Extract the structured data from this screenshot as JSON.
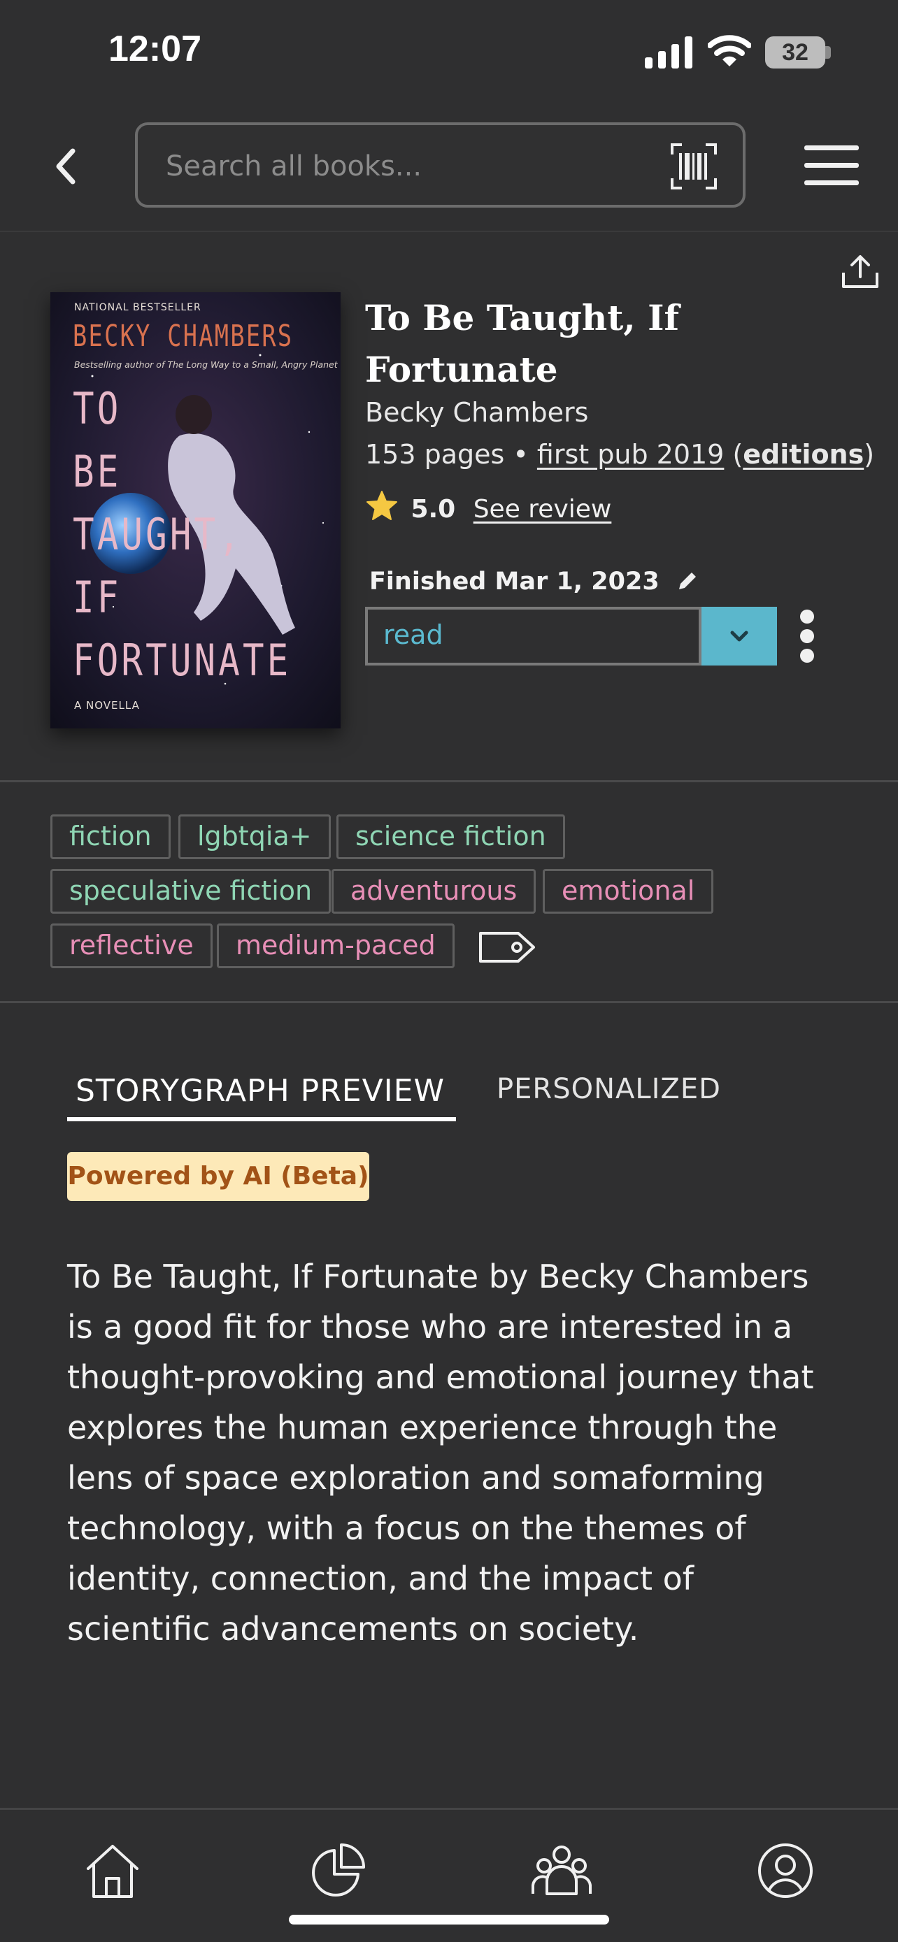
{
  "status_bar": {
    "time": "12:07",
    "battery": "32"
  },
  "header": {
    "search_placeholder": "Search all books...",
    "back_icon": "chevron-left-icon",
    "barcode_icon": "barcode-scan-icon",
    "menu_icon": "hamburger-menu-icon"
  },
  "book": {
    "title": "To Be Taught, If Fortunate",
    "author": "Becky Chambers",
    "pages": "153 pages",
    "separator": " • ",
    "first_pub": "first pub 2019",
    "editions_open": " (",
    "editions": "editions",
    "editions_close": ")",
    "rating": "5.0",
    "see_review": "See review",
    "finished": "Finished Mar 1, 2023",
    "status": "read",
    "cover": {
      "badge": "NATIONAL BESTSELLER",
      "author": "BECKY CHAMBERS",
      "tagline_pre": "Bestselling author of ",
      "tagline_title": "The Long Way to a Small, Angry Planet",
      "title_lines": [
        "TO",
        "BE",
        "TAUGHT,",
        "IF",
        "FORTUNATE"
      ],
      "subtitle": "A NOVELLA"
    }
  },
  "tags": {
    "genres": [
      "fiction",
      "lgbtqia+",
      "science fiction",
      "speculative fiction"
    ],
    "moods": [
      "adventurous",
      "emotional",
      "reflective",
      "medium-paced"
    ]
  },
  "tabs": {
    "preview": "STORYGRAPH PREVIEW",
    "personalized": "PERSONALIZED"
  },
  "ai_badge": "Powered by AI (Beta)",
  "preview_text": "To Be Taught, If Fortunate by Becky Chambers is a good fit for those who are interested in a thought-provoking and emotional journey that explores the human experience through the lens of space exploration and somaforming technology, with a focus on the themes of identity, connection, and the impact of scientific advancements on society.",
  "bottom_nav": [
    "home-icon",
    "stats-pie-icon",
    "community-icon",
    "profile-icon"
  ],
  "colors": {
    "background": "#2f2f30",
    "accent_teal": "#5bb7cc",
    "genre_tag": "#8fd6b4",
    "mood_tag": "#e88fb7",
    "ai_badge_bg": "#fde9b8",
    "ai_badge_text": "#a25317",
    "star": "#f5c842"
  }
}
